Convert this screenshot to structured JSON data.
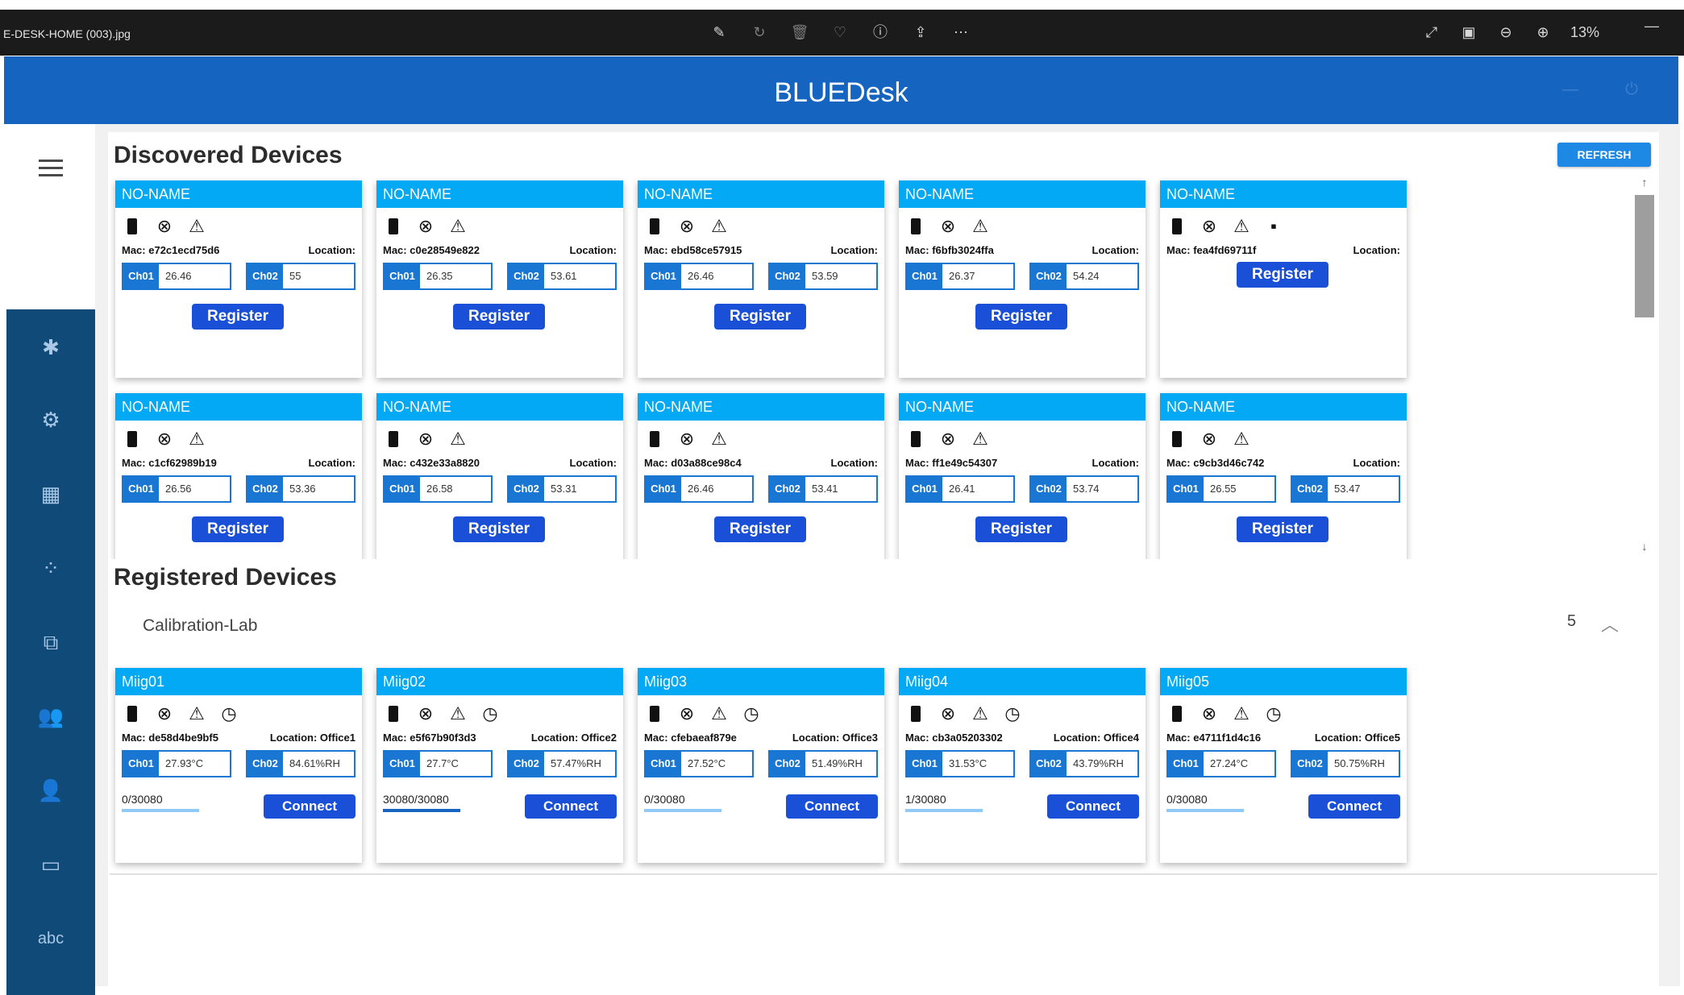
{
  "viewer": {
    "file_name": "E-DESK-HOME (003).jpg",
    "zoom": "13%",
    "tool_icons": [
      "edit-icon",
      "rotate-icon",
      "delete-icon",
      "heart-icon",
      "info-icon",
      "share-icon",
      "more-icon"
    ],
    "right_icons": [
      "expand-icon",
      "fit-icon",
      "zoom-out-icon",
      "zoom-in-icon"
    ]
  },
  "app": {
    "title": "BLUEDesk",
    "accent": "#1565c0",
    "card_header_color": "#03a9f4",
    "button_color": "#1a4fd8"
  },
  "sidebar": {
    "items": [
      "bluetooth-icon",
      "settings-icon",
      "calendar-icon",
      "loading-icon",
      "screens-icon",
      "group-icon",
      "person-icon",
      "devices-icon",
      "abc-icon"
    ]
  },
  "discovered": {
    "title": "Discovered Devices",
    "refresh_label": "REFRESH",
    "register_label": "Register",
    "location_label": "Location:",
    "ch1_label": "Ch01",
    "ch2_label": "Ch02",
    "devices": [
      {
        "name": "NO-NAME",
        "mac": "Mac: e72c1ecd75d6",
        "ch1": "26.46",
        "ch2": "55",
        "alert": false
      },
      {
        "name": "NO-NAME",
        "mac": "Mac: c0e28549e822",
        "ch1": "26.35",
        "ch2": "53.61",
        "alert": false
      },
      {
        "name": "NO-NAME",
        "mac": "Mac: ebd58ce57915",
        "ch1": "26.46",
        "ch2": "53.59",
        "alert": false
      },
      {
        "name": "NO-NAME",
        "mac": "Mac: f6bfb3024ffa",
        "ch1": "26.37",
        "ch2": "54.24",
        "alert": true
      },
      {
        "name": "NO-NAME",
        "mac": "Mac: fea4fd69711f",
        "ch1": "",
        "ch2": "",
        "alert": false
      },
      {
        "name": "NO-NAME",
        "mac": "Mac: c1cf62989b19",
        "ch1": "26.56",
        "ch2": "53.36",
        "alert": false
      },
      {
        "name": "NO-NAME",
        "mac": "Mac: c432e33a8820",
        "ch1": "26.58",
        "ch2": "53.31",
        "alert": false
      },
      {
        "name": "NO-NAME",
        "mac": "Mac: d03a88ce98c4",
        "ch1": "26.46",
        "ch2": "53.41",
        "alert": false
      },
      {
        "name": "NO-NAME",
        "mac": "Mac: ff1e49c54307",
        "ch1": "26.41",
        "ch2": "53.74",
        "alert": true
      },
      {
        "name": "NO-NAME",
        "mac": "Mac: c9cb3d46c742",
        "ch1": "26.55",
        "ch2": "53.47",
        "alert": false
      }
    ]
  },
  "registered": {
    "title": "Registered Devices",
    "group_name": "Calibration-Lab",
    "group_count": "5",
    "connect_label": "Connect",
    "devices": [
      {
        "name": "Miig01",
        "mac": "Mac: de58d4be9bf5",
        "location": "Location: Office1",
        "ch1": "27.93°C",
        "ch2": "84.61%RH",
        "counter": "0/30080",
        "progress": 0
      },
      {
        "name": "Miig02",
        "mac": "Mac: e5f67b90f3d3",
        "location": "Location: Office2",
        "ch1": "27.7°C",
        "ch2": "57.47%RH",
        "counter": "30080/30080",
        "progress": 1
      },
      {
        "name": "Miig03",
        "mac": "Mac: cfebaeaf879e",
        "location": "Location: Office3",
        "ch1": "27.52°C",
        "ch2": "51.49%RH",
        "counter": "0/30080",
        "progress": 0
      },
      {
        "name": "Miig04",
        "mac": "Mac: cb3a05203302",
        "location": "Location: Office4",
        "ch1": "31.53°C",
        "ch2": "43.79%RH",
        "counter": "1/30080",
        "progress": 0
      },
      {
        "name": "Miig05",
        "mac": "Mac: e4711f1d4c16",
        "location": "Location: Office5",
        "ch1": "27.24°C",
        "ch2": "50.75%RH",
        "counter": "0/30080",
        "progress": 0
      }
    ]
  }
}
